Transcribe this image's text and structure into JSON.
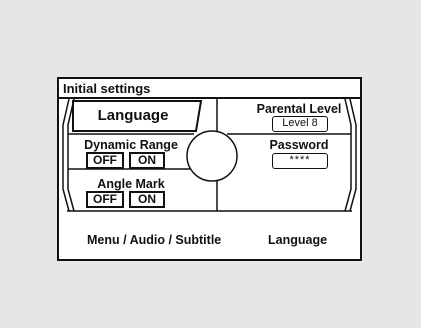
{
  "screen": {
    "title": "Initial settings",
    "language_label": "Language",
    "dynamic_range": {
      "label": "Dynamic Range",
      "off": "OFF",
      "on": "ON"
    },
    "angle_mark": {
      "label": "Angle Mark",
      "off": "OFF",
      "on": "ON"
    },
    "parental_level": {
      "label": "Parental Level",
      "value": "Level 8"
    },
    "password": {
      "label": "Password",
      "value": "****"
    },
    "footer_left": "Menu / Audio / Subtitle",
    "footer_right": "Language"
  }
}
